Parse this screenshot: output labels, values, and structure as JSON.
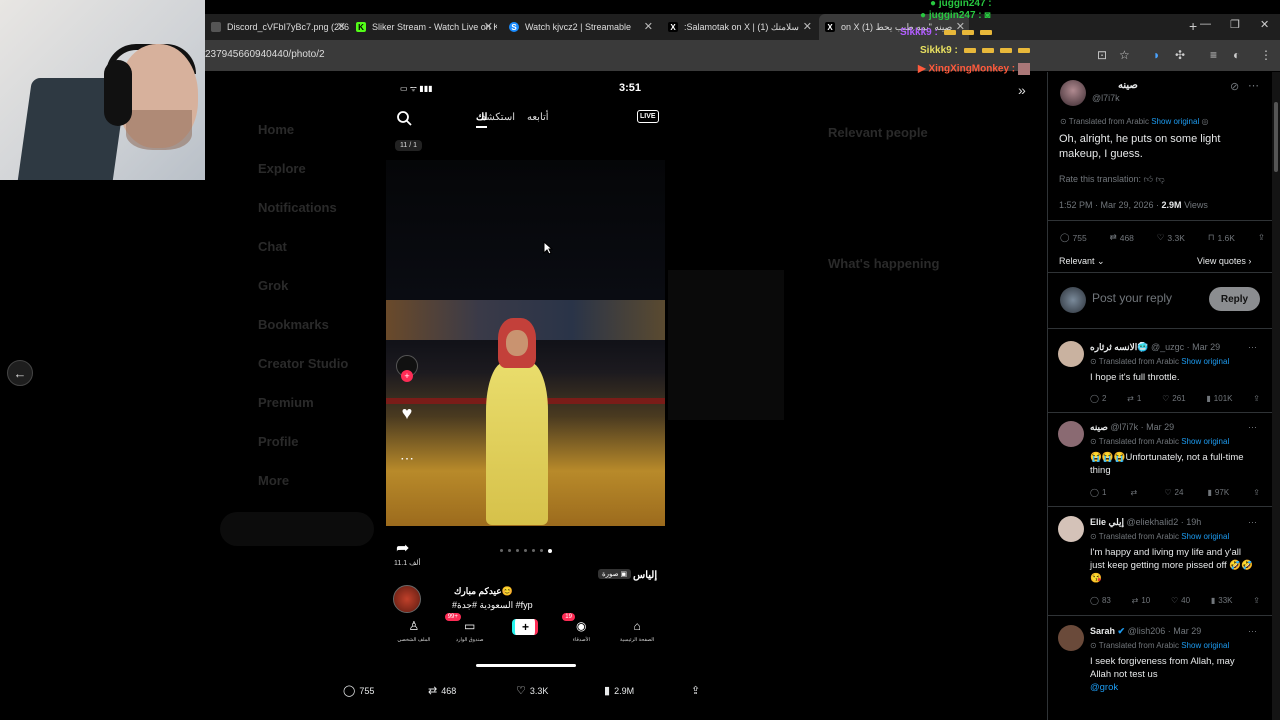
{
  "browser": {
    "tabs": [
      {
        "title": "Discord_cVFbI7yBc7.png (286×",
        "fav": "",
        "fav_color": "#555555"
      },
      {
        "title": "Sliker Stream - Watch Live on K",
        "fav": "K",
        "fav_color": "#53fc18"
      },
      {
        "title": "Watch kjvcz2 | Streamable",
        "fav": "S",
        "fav_color": "#1a8cff"
      },
      {
        "title": ":Salamotak on X | سلامتك (1)",
        "fav": "X",
        "fav_color": "#000000"
      },
      {
        "title": "on X (1) صينه \"يمه طيب يحط",
        "fav": "X",
        "fav_color": "#000000"
      }
    ],
    "url": "237945660940440/photo/2"
  },
  "chat": [
    {
      "user": "juggin247 :",
      "color": "#28c840"
    },
    {
      "user": "Sikkk9 :",
      "color": "#b05cff"
    },
    {
      "user": "Sikkk9 :",
      "color": "#e8e060"
    },
    {
      "user": "XingXingMonkey :",
      "color": "#ff5a3c"
    }
  ],
  "bg_nav": [
    "Home",
    "Explore",
    "Notifications",
    "Chat",
    "Grok",
    "Bookmarks",
    "Creator Studio",
    "Premium",
    "Profile",
    "More"
  ],
  "bg_right": {
    "relevant": "Relevant people",
    "happening": "What's happening"
  },
  "phone": {
    "time": "3:51",
    "tabs": [
      "استكشف",
      "أتابعه",
      "لك"
    ],
    "live": "LIVE",
    "counter": "11 / 1",
    "share_count": "11.1 ألف",
    "author": "إلياس",
    "image_tag": "صورة",
    "caption1": "عيدكم مبارك😊",
    "caption2": "#السعودية #جدة #fyp",
    "nav": [
      {
        "label": "الملف الشخصي",
        "icon": "♙"
      },
      {
        "label": "صندوق الوارد",
        "icon": "▭",
        "badge": "99+"
      },
      {
        "label": "",
        "icon": "+"
      },
      {
        "label": "الأصدقاء",
        "icon": "◉",
        "badge": "19"
      },
      {
        "label": "الصفحة الرئيسية",
        "icon": "⌂"
      }
    ]
  },
  "actions": {
    "replies": "755",
    "reposts": "468",
    "likes": "3.3K",
    "views": "2.9M"
  },
  "post": {
    "name": "صينه",
    "handle": "@l7i7k",
    "translated": "Translated from Arabic",
    "show_original": "Show original",
    "text": "Oh, alright, he puts on some light makeup, I guess.",
    "rate": "Rate this translation:",
    "time": "1:52 PM · Mar 29, 2026 · ",
    "views": "2.9M",
    "views_label": "Views",
    "replies": "755",
    "reposts": "468",
    "likes": "3.3K",
    "bookmarks": "1.6K",
    "sort": "Relevant",
    "view_quotes": "View quotes",
    "reply_placeholder": "Post your reply",
    "reply_button": "Reply"
  },
  "replies": [
    {
      "name": "الانسه ثرثاره🥶",
      "handle": "@_uzgc · Mar 29",
      "text": "I hope it's full throttle.",
      "link": "",
      "r": "2",
      "rt": "1",
      "l": "261",
      "v": "101K",
      "avatar_color": "#c9b2a0"
    },
    {
      "name": "صينه",
      "handle": "@l7i7k · Mar 29",
      "text": "😭😭😭Unfortunately, not a full-time thing",
      "link": "",
      "r": "1",
      "rt": "",
      "l": "24",
      "v": "97K",
      "avatar_color": "#8a6a72"
    },
    {
      "name": "Elie إيلي",
      "handle": "@eliekhalid2 · 19h",
      "text": "I'm happy and living my life and y'all just keep getting more pissed off 🤣🤣😘",
      "link": "",
      "r": "83",
      "rt": "10",
      "l": "40",
      "v": "33K",
      "avatar_color": "#d4c2b8"
    },
    {
      "name": "Sarah",
      "handle": "@lish206 · Mar 29",
      "text": "I seek forgiveness from Allah, may Allah not test us",
      "link": "@grok",
      "r": "",
      "rt": "",
      "l": "",
      "v": "",
      "avatar_color": "#6a4a3a"
    }
  ]
}
